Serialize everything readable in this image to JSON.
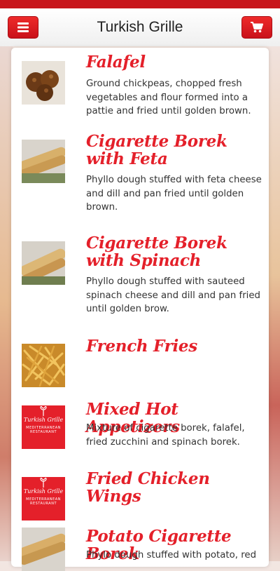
{
  "header": {
    "title": "Turkish Grille",
    "menu_icon": "hamburger-menu-icon",
    "cart_icon": "shopping-cart-icon"
  },
  "colors": {
    "brand_red": "#e4202a",
    "button_red": "#d81a20"
  },
  "menu_items": [
    {
      "name": "Falafel",
      "description": "Ground chickpeas, chopped fresh vegetables and flour formed into a pattie and fried until golden brown."
    },
    {
      "name": "Cigarette Borek with Feta",
      "description": "Phyllo dough stuffed with feta cheese and dill and pan fried until golden brown."
    },
    {
      "name": "Cigarette Borek with Spinach",
      "description": "Phyllo dough stuffed with sauteed spinach cheese and dill and pan fried until golden brow."
    },
    {
      "name": "French Fries",
      "description": ""
    },
    {
      "name": "Mixed Hot Appetizers",
      "description": "Mixture of cigarette borek, falafel, fried zucchini and spinach borek."
    },
    {
      "name": "Fried Chicken Wings",
      "description": ""
    },
    {
      "name": "Potato Cigarette Borek",
      "description": "Phylo dough stuffed with potato, red"
    }
  ],
  "logo": {
    "brand": "Turkish Grille",
    "tagline": "MEDITERRANEAN RESTAURANT"
  }
}
